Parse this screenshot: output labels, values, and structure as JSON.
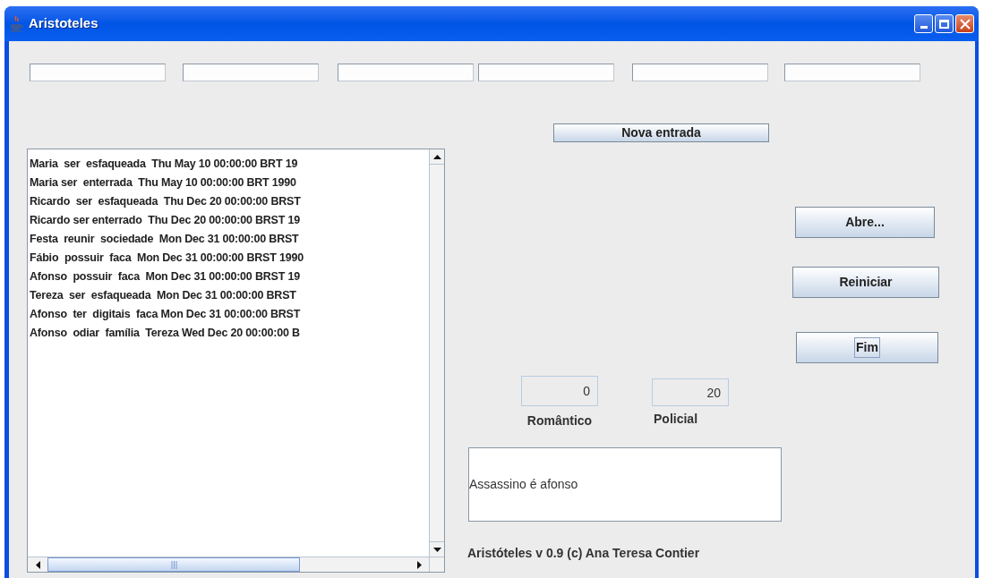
{
  "window": {
    "title": "Aristoteles"
  },
  "entry_fields": [
    {
      "kind": "text"
    },
    {
      "kind": "text"
    },
    {
      "kind": "text"
    },
    {
      "kind": "text"
    },
    {
      "kind": "text"
    },
    {
      "kind": "text"
    }
  ],
  "new_entry_button": "Nova entrada",
  "events": [
    "Maria  ser  esfaqueada  Thu May 10 00:00:00 BRT 19",
    "Maria ser  enterrada  Thu May 10 00:00:00 BRT 1990",
    "Ricardo  ser  esfaqueada  Thu Dec 20 00:00:00 BRST",
    "Ricardo ser enterrado  Thu Dec 20 00:00:00 BRST 19",
    "Festa  reunir  sociedade  Mon Dec 31 00:00:00 BRST",
    "Fábio  possuir  faca  Mon Dec 31 00:00:00 BRST 1990",
    "Afonso  possuir  faca  Mon Dec 31 00:00:00 BRST 19",
    "Tereza  ser  esfaqueada  Mon Dec 31 00:00:00 BRST",
    "Afonso  ter  digitais  faca Mon Dec 31 00:00:00 BRST",
    "Afonso  odiar  família  Tereza Wed Dec 20 00:00:00 B"
  ],
  "buttons": [
    {
      "label": "Abre...",
      "focused": false
    },
    {
      "label": "Reiniciar",
      "focused": false
    },
    {
      "label": "Fim",
      "focused": true
    }
  ],
  "counters": [
    {
      "value": "0",
      "label": "Romântico"
    },
    {
      "value": "20",
      "label": "Policial"
    }
  ],
  "result": "Assassino é afonso",
  "credit": "Aristóteles v 0.9 (c) Ana Teresa Contier"
}
